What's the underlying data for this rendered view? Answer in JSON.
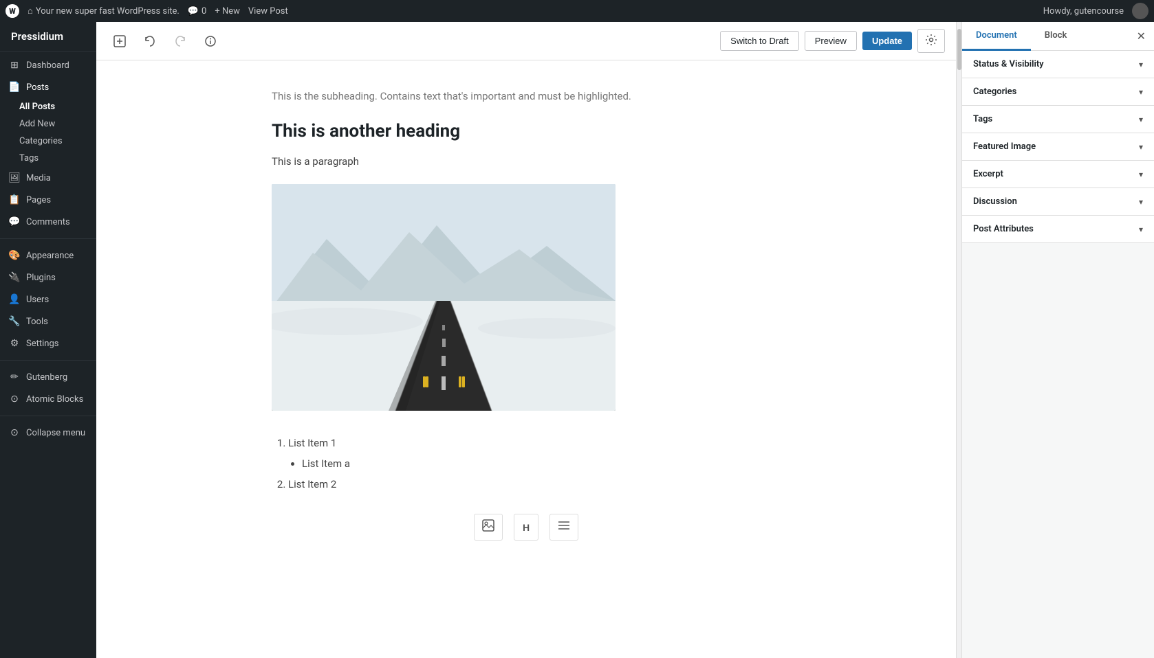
{
  "admin_bar": {
    "wp_icon_label": "W",
    "site_name": "Your new super fast WordPress site.",
    "comments_label": "Comments",
    "comments_count": "0",
    "new_label": "+ New",
    "view_post_label": "View Post",
    "howdy_label": "Howdy, gutencourse"
  },
  "sidebar": {
    "brand": "Pressidium",
    "items": [
      {
        "id": "dashboard",
        "label": "Dashboard",
        "icon": "⊞"
      },
      {
        "id": "posts",
        "label": "Posts",
        "icon": "📄",
        "active": true
      },
      {
        "id": "media",
        "label": "Media",
        "icon": "🖼"
      },
      {
        "id": "pages",
        "label": "Pages",
        "icon": "📋"
      },
      {
        "id": "comments",
        "label": "Comments",
        "icon": "💬"
      },
      {
        "id": "appearance",
        "label": "Appearance",
        "icon": "🎨"
      },
      {
        "id": "plugins",
        "label": "Plugins",
        "icon": "🔌"
      },
      {
        "id": "users",
        "label": "Users",
        "icon": "👤"
      },
      {
        "id": "tools",
        "label": "Tools",
        "icon": "🔧"
      },
      {
        "id": "settings",
        "label": "Settings",
        "icon": "⚙"
      },
      {
        "id": "gutenberg",
        "label": "Gutenberg",
        "icon": "✏"
      },
      {
        "id": "atomic-blocks",
        "label": "Atomic Blocks",
        "icon": "⊙"
      }
    ],
    "posts_sub": [
      {
        "id": "all-posts",
        "label": "All Posts",
        "active": true
      },
      {
        "id": "add-new",
        "label": "Add New"
      },
      {
        "id": "categories",
        "label": "Categories"
      },
      {
        "id": "tags",
        "label": "Tags"
      }
    ],
    "collapse_label": "Collapse menu"
  },
  "editor": {
    "toolbar": {
      "add_block_label": "+",
      "undo_label": "↩",
      "redo_label": "↪",
      "info_label": "ℹ",
      "switch_draft_label": "Switch to Draft",
      "preview_label": "Preview",
      "update_label": "Update",
      "settings_label": "⚙"
    },
    "content": {
      "subheading": "This is the subheading. Contains text that's important and must be highlighted.",
      "heading": "This is another heading",
      "paragraph": "This is a paragraph",
      "list_items": [
        {
          "text": "List Item 1",
          "sub": [
            {
              "text": "List Item a"
            }
          ]
        },
        {
          "text": "List Item 2",
          "sub": []
        }
      ]
    },
    "block_tools": [
      {
        "id": "image",
        "label": "🖼"
      },
      {
        "id": "heading",
        "label": "H"
      },
      {
        "id": "list",
        "label": "≡"
      }
    ]
  },
  "right_panel": {
    "tabs": [
      {
        "id": "document",
        "label": "Document",
        "active": true
      },
      {
        "id": "block",
        "label": "Block"
      }
    ],
    "close_label": "✕",
    "sections": [
      {
        "id": "status-visibility",
        "label": "Status & Visibility"
      },
      {
        "id": "categories",
        "label": "Categories"
      },
      {
        "id": "tags",
        "label": "Tags"
      },
      {
        "id": "featured-image",
        "label": "Featured Image"
      },
      {
        "id": "excerpt",
        "label": "Excerpt"
      },
      {
        "id": "discussion",
        "label": "Discussion"
      },
      {
        "id": "post-attributes",
        "label": "Post Attributes"
      }
    ]
  }
}
